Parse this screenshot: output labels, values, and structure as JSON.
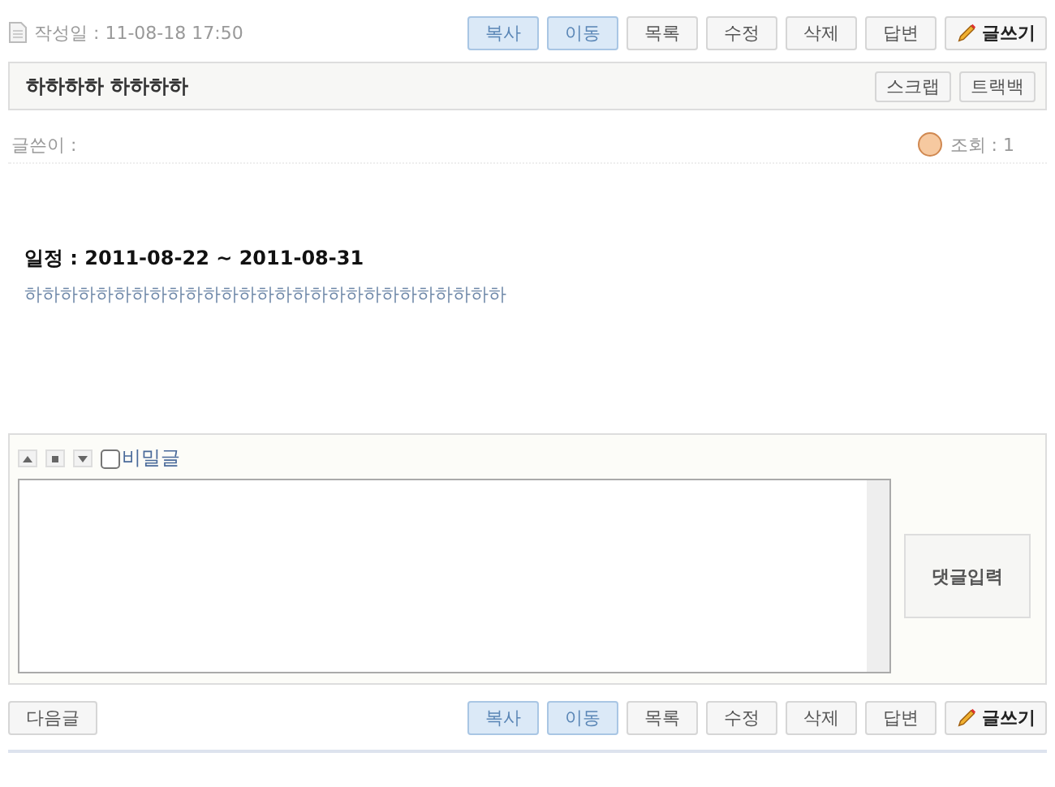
{
  "top_bar": {
    "date_label": "작성일 : 11-08-18 17:50",
    "buttons": [
      {
        "label": "복사",
        "kind": "highlight"
      },
      {
        "label": "이동",
        "kind": "highlight"
      },
      {
        "label": "목록",
        "kind": "plain"
      },
      {
        "label": "수정",
        "kind": "plain"
      },
      {
        "label": "삭제",
        "kind": "plain"
      },
      {
        "label": "답변",
        "kind": "plain"
      },
      {
        "label": "글쓰기",
        "kind": "write"
      }
    ]
  },
  "title_bar": {
    "title": "하하하하 하하하하",
    "buttons": [
      "스크랩",
      "트랙백"
    ]
  },
  "author_row": {
    "author_label": "글쓴이 :",
    "views": "조회 : 1"
  },
  "content": {
    "schedule": "일정 : 2011-08-22 ~ 2011-08-31",
    "body": "하하하하하하하하하하하하하하하하하하하하하하하하하하하"
  },
  "comment": {
    "secret": {
      "label": "비밀글",
      "checked": false
    },
    "submit": "댓글입력"
  },
  "bottom_bar": {
    "next": "다음글",
    "buttons": [
      {
        "label": "복사",
        "kind": "highlight"
      },
      {
        "label": "이동",
        "kind": "highlight"
      },
      {
        "label": "목록",
        "kind": "plain"
      },
      {
        "label": "수정",
        "kind": "plain"
      },
      {
        "label": "삭제",
        "kind": "plain"
      },
      {
        "label": "답변",
        "kind": "plain"
      },
      {
        "label": "글쓰기",
        "kind": "write"
      }
    ]
  }
}
